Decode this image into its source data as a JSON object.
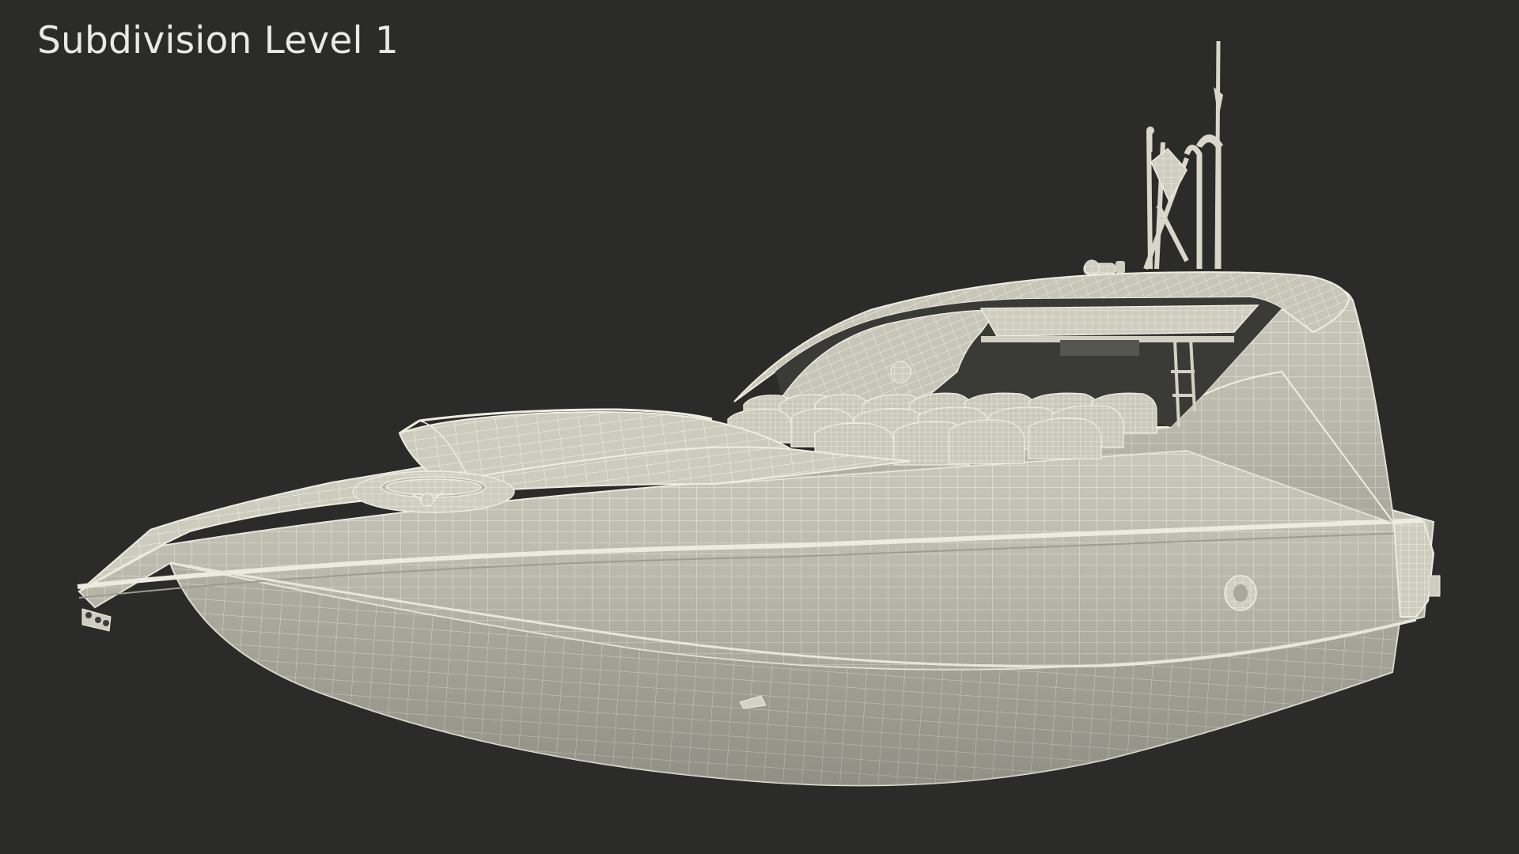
{
  "caption": "Subdivision Level 1",
  "scene": {
    "subject": "boat-wireframe-render",
    "colors": {
      "background": "#2b2c2a",
      "mesh_fill": "#c8c7b8",
      "mesh_fill_light": "#d6d5c7",
      "mesh_fill_dark": "#a7a699",
      "wire": "#f4f2e6",
      "shadow": "#8c8b7f",
      "caption": "#e9e9e6"
    }
  }
}
